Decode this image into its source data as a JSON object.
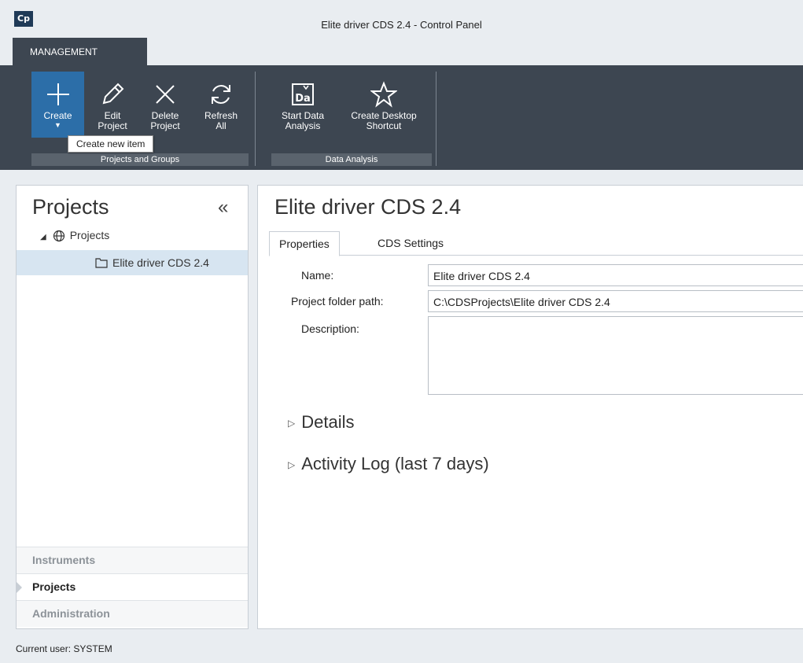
{
  "window": {
    "title": "Elite driver CDS 2.4 - Control Panel",
    "logo_text": "Cp"
  },
  "ribbon": {
    "tab": "MANAGEMENT",
    "buttons": [
      {
        "label": "Create",
        "icon": "plus-icon"
      },
      {
        "label": "Edit\nProject",
        "icon": "pencil-icon"
      },
      {
        "label": "Delete\nProject",
        "icon": "close-icon"
      },
      {
        "label": "Refresh\nAll",
        "icon": "refresh-icon"
      },
      {
        "label": "Start Data\nAnalysis",
        "icon": "data-analysis-icon"
      },
      {
        "label": "Create Desktop\nShortcut",
        "icon": "star-icon"
      }
    ],
    "groups": [
      {
        "label": "Projects and Groups"
      },
      {
        "label": "Data Analysis"
      }
    ],
    "tooltip": "Create new item"
  },
  "left": {
    "title": "Projects",
    "collapse": "«",
    "tree_root": "Projects",
    "tree_child": "Elite driver CDS 2.4",
    "nav": [
      "Instruments",
      "Projects",
      "Administration"
    ]
  },
  "main": {
    "title": "Elite driver CDS 2.4",
    "tabs": [
      "Properties",
      "CDS Settings"
    ],
    "fields": {
      "name_label": "Name:",
      "name_value": "Elite driver CDS 2.4",
      "path_label": "Project folder path:",
      "path_value": "C:\\CDSProjects\\Elite driver CDS 2.4",
      "desc_label": "Description:",
      "desc_value": ""
    },
    "sections": [
      "Details",
      "Activity Log (last 7 days)"
    ]
  },
  "status": {
    "text": "Current user: SYSTEM"
  }
}
